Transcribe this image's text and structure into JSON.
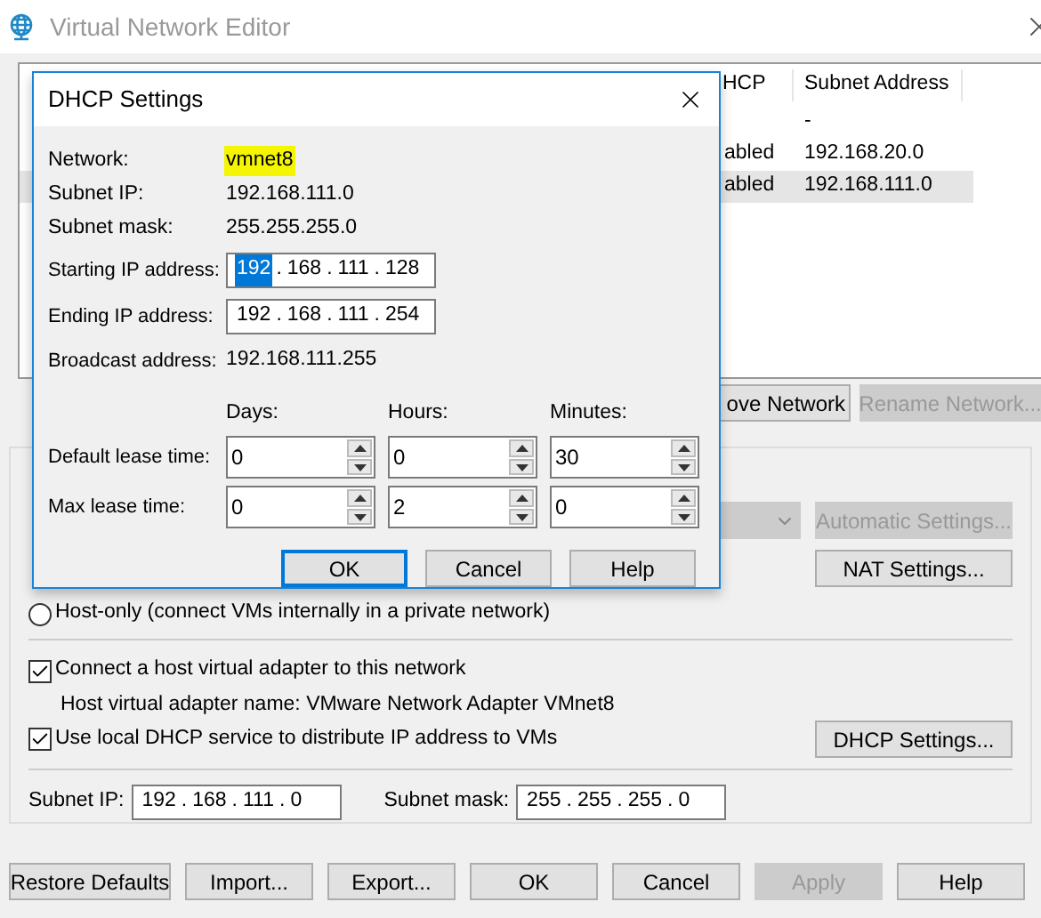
{
  "window": {
    "title": "Virtual Network Editor"
  },
  "table": {
    "columns": [
      {
        "label": "HCP"
      },
      {
        "label": "Subnet Address"
      }
    ],
    "rows": [
      {
        "subnet_address": "-",
        "selected": false
      },
      {
        "dhcp": "abled",
        "subnet_address": "192.168.20.0",
        "selected": false
      },
      {
        "dhcp": "abled",
        "subnet_address": "192.168.111.0",
        "selected": true
      }
    ]
  },
  "network_buttons": [
    {
      "label": "ove Network",
      "disabled": false
    },
    {
      "label": "Rename Network...",
      "disabled": true
    }
  ],
  "nat_dropdown": {
    "disabled": true
  },
  "automatic_settings": {
    "label": "Automatic Settings...",
    "disabled": true
  },
  "nat_settings": {
    "label": "NAT Settings...",
    "disabled": false
  },
  "host_only": {
    "label": "Host-only (connect VMs internally in a private network)",
    "selected": false
  },
  "connect_adapter": {
    "label": "Connect a host virtual adapter to this network",
    "checked": true
  },
  "adapter_name": "Host virtual adapter name: VMware Network Adapter VMnet8",
  "use_dhcp": {
    "label": "Use local DHCP service to distribute IP address to VMs",
    "checked": true
  },
  "dhcp_settings": {
    "label": "DHCP Settings...",
    "disabled": false
  },
  "subnet_ip": {
    "label": "Subnet IP:",
    "octets": [
      {
        "text": "192",
        "selected": false
      },
      {
        "text": "168",
        "selected": false
      },
      {
        "text": "111",
        "selected": false
      },
      {
        "text": "0",
        "selected": false
      }
    ]
  },
  "subnet_mask": {
    "label": "Subnet mask:",
    "octets": [
      {
        "text": "255",
        "selected": false
      },
      {
        "text": "255",
        "selected": false
      },
      {
        "text": "255",
        "selected": false
      },
      {
        "text": "0",
        "selected": false
      }
    ]
  },
  "ip_separator": ".",
  "footer_buttons": [
    {
      "label": "Restore Defaults",
      "disabled": false
    },
    {
      "label": "Import...",
      "disabled": false
    },
    {
      "label": "Export...",
      "disabled": false
    },
    {
      "label": "OK",
      "disabled": false
    },
    {
      "label": "Cancel",
      "disabled": false
    },
    {
      "label": "Apply",
      "disabled": true
    },
    {
      "label": "Help",
      "disabled": false
    }
  ],
  "dialog": {
    "title": "DHCP Settings",
    "info": [
      {
        "label": "Network:",
        "value": "vmnet8",
        "highlighted": true
      },
      {
        "label": "Subnet IP:",
        "value": "192.168.111.0",
        "highlighted": false
      },
      {
        "label": "Subnet mask:",
        "value": "255.255.255.0",
        "highlighted": false
      }
    ],
    "starting_ip": {
      "label": "Starting IP address:",
      "octets": [
        {
          "text": "192",
          "selected": true
        },
        {
          "text": "168",
          "selected": false
        },
        {
          "text": "111",
          "selected": false
        },
        {
          "text": "128",
          "selected": false
        }
      ]
    },
    "ending_ip": {
      "label": "Ending IP address:",
      "octets": [
        {
          "text": "192",
          "selected": false
        },
        {
          "text": "168",
          "selected": false
        },
        {
          "text": "111",
          "selected": false
        },
        {
          "text": "254",
          "selected": false
        }
      ]
    },
    "broadcast": {
      "label": "Broadcast address:",
      "value": "192.168.111.255"
    },
    "lease_columns": [
      "Days:",
      "Hours:",
      "Minutes:"
    ],
    "leases": [
      {
        "label": "Default lease time:",
        "values": [
          "0",
          "0",
          "30"
        ]
      },
      {
        "label": "Max lease time:",
        "values": [
          "0",
          "2",
          "0"
        ]
      }
    ],
    "buttons": [
      {
        "label": "OK",
        "default": true
      },
      {
        "label": "Cancel",
        "default": false
      },
      {
        "label": "Help",
        "default": false
      }
    ]
  }
}
